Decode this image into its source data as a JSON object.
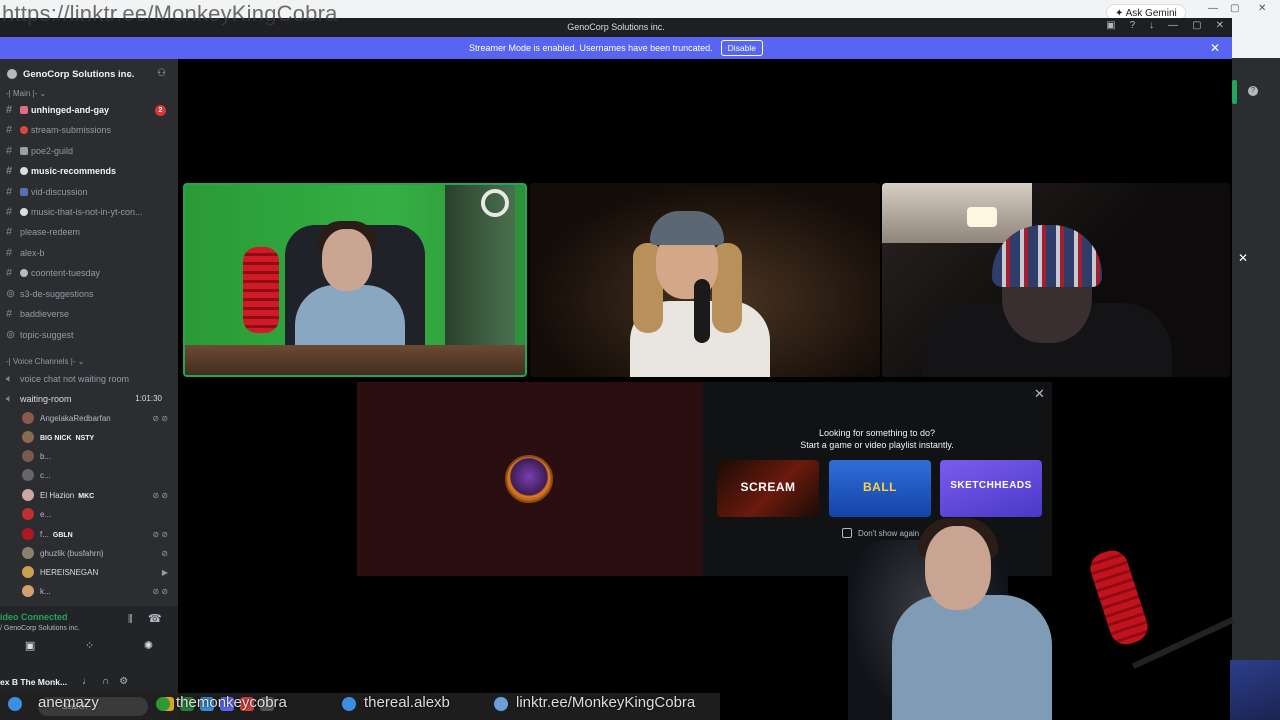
{
  "browser": {
    "overlay_url_top": "https://linktr.ee/MonkeyKingCobra",
    "gemini_label": "Ask Gemini"
  },
  "window": {
    "title": "GenoCorp Solutions inc."
  },
  "banner": {
    "text": "Streamer Mode is enabled. Usernames have been truncated.",
    "disable_label": "Disable"
  },
  "server": {
    "name": "GenoCorp Solutions inc."
  },
  "sidebar": {
    "category_main": "-| Main |-",
    "channels": [
      {
        "name": "unhinged-and-gay",
        "unread": true,
        "badge": "2",
        "emoji_color": "#e06c8a"
      },
      {
        "name": "stream-submissions",
        "unread": false,
        "emoji_color": "#e0463c"
      },
      {
        "name": "poe2-guild",
        "unread": false,
        "emoji_color": "#9aa0a6"
      },
      {
        "name": "music-recommends",
        "unread": true,
        "emoji_color": "#dbdee1"
      },
      {
        "name": "vid-discussion",
        "unread": false,
        "emoji_color": "#5b6fb0"
      },
      {
        "name": "music-that-is-not-in-yt-con...",
        "unread": false,
        "emoji_color": "#dbdee1"
      },
      {
        "name": "please-redeem",
        "unread": false
      },
      {
        "name": "alex-b",
        "unread": false
      },
      {
        "name": "coontent-tuesday",
        "unread": false,
        "emoji_color": "#b5bac1"
      },
      {
        "name": "s3-de-suggestions",
        "unread": false
      },
      {
        "name": "baddieverse",
        "unread": false
      },
      {
        "name": "topic-suggest",
        "unread": false
      }
    ],
    "category_voice": "-| Voice Channels |-",
    "voice_channels": [
      {
        "name": "voice chat not waiting room"
      },
      {
        "name": "waiting-room",
        "timer": "1:01:30"
      }
    ],
    "voice_users": [
      {
        "name": "AngelakaRedbarfan",
        "avatar": "#8a5a4a"
      },
      {
        "name": "BIG NICK",
        "tag": "NSTY",
        "avatar": "#8a6a50"
      },
      {
        "name": "b...",
        "avatar": "#7a5a50"
      },
      {
        "name": "c...",
        "avatar": "#666"
      },
      {
        "name": "El Hazion",
        "tag": "MKC",
        "avatar": "#caa"
      },
      {
        "name": "e...",
        "avatar": "#c03030"
      },
      {
        "name": "f...",
        "tag": "GBLN",
        "avatar": "#b01820"
      },
      {
        "name": "ghuzlik (busfahrn)",
        "avatar": "#8a8070"
      },
      {
        "name": "HEREISNEGAN",
        "avatar": "#c8a050"
      },
      {
        "name": "k...",
        "avatar": "#d0a070"
      }
    ]
  },
  "voice_panel": {
    "status": "ideo Connected",
    "sub": "/ GenoCorp Solutions inc.",
    "user_name": "ex B The Monk..."
  },
  "taskbar": {
    "search_placeholder": "Search",
    "overlay_links": [
      "anemazy",
      "themonkeycobra",
      "thereal.alexb",
      "linktr.ee/MonkeyKingCobra"
    ]
  },
  "activity": {
    "title_line1": "Looking for something to do?",
    "title_line2": "Start a game or video playlist instantly.",
    "cards": [
      {
        "label": "SCREAM"
      },
      {
        "label": "BALL"
      },
      {
        "label": "SKETCHHEADS"
      }
    ],
    "dont_show": "Don't show again"
  },
  "icons": {
    "close": "×",
    "hash": "#",
    "speaker": "◀)"
  },
  "colors": {
    "blurple": "#5865f2",
    "green": "#23a559",
    "sidebar_bg": "#2b2d31",
    "screen_share_bg": "#2b0f10"
  }
}
